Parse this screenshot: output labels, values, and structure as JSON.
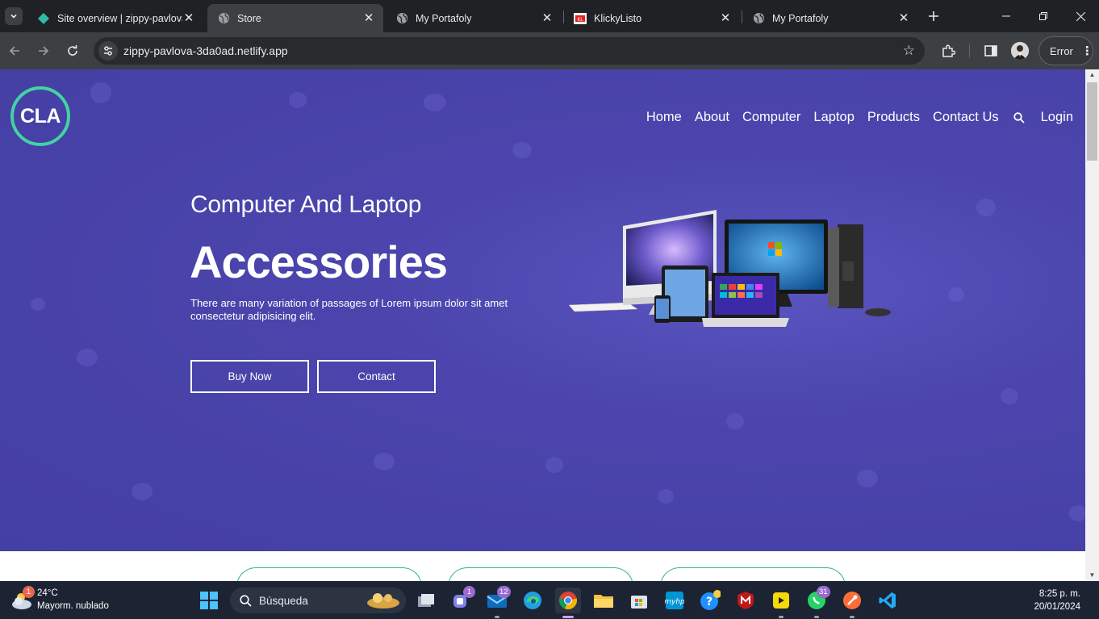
{
  "browser": {
    "tabs": [
      {
        "title": "Site overview | zippy-pavlova",
        "favicon": "netlify-diamond-icon",
        "active": false
      },
      {
        "title": "Store",
        "favicon": "globe-icon",
        "active": true
      },
      {
        "title": "My Portafoly",
        "favicon": "globe-icon",
        "active": false
      },
      {
        "title": "KlickyListo",
        "favicon": "klickylisto-icon",
        "active": false
      },
      {
        "title": "My Portafoly",
        "favicon": "globe-icon",
        "active": false
      }
    ],
    "url": "zippy-pavlova-3da0ad.netlify.app",
    "profile_status": "Error"
  },
  "site": {
    "logo": "CLA",
    "nav": [
      "Home",
      "About",
      "Computer",
      "Laptop",
      "Products",
      "Contact Us"
    ],
    "login": "Login",
    "hero": {
      "subtitle": "Computer And Laptop",
      "title": "Accessories",
      "text": "There are many variation of passages of Lorem ipsum dolor sit amet consectetur adipisicing elit.",
      "buy_button": "Buy Now",
      "contact_button": "Contact"
    },
    "colors": {
      "hero_bg": "#443fa3",
      "logo_ring": "#43d3a2",
      "card_border": "#2fb58a"
    }
  },
  "taskbar": {
    "weather": {
      "badge": "1",
      "temp": "24°C",
      "condition": "Mayorm. nublado"
    },
    "search_label": "Búsqueda",
    "badges": {
      "teams": "1",
      "mail": "12",
      "whatsapp": "31"
    },
    "time": "8:25 p. m.",
    "date": "20/01/2024"
  }
}
